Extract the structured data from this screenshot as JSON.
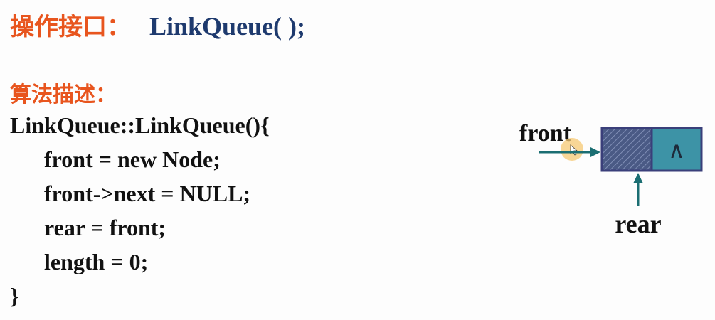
{
  "title": {
    "label": "操作接口：",
    "operation": "LinkQueue( );"
  },
  "algorithm": {
    "label": "算法描述：",
    "code_lines": [
      "LinkQueue::LinkQueue(){",
      "front = new Node;",
      "front->next = NULL;",
      "rear = front;",
      "length = 0;",
      "}"
    ]
  },
  "diagram": {
    "front_label": "front",
    "rear_label": "rear",
    "null_symbol": "∧",
    "colors": {
      "node_border": "#3a3f7a",
      "data_cell_fill": "#4a5a85",
      "next_cell_fill": "#3d93a6",
      "arrow": "#1b6e72",
      "cursor_highlight": "#f5c873"
    }
  },
  "colors": {
    "heading_orange": "#e8551e",
    "operation_navy": "#1e3a6e",
    "code_text": "#111111"
  }
}
